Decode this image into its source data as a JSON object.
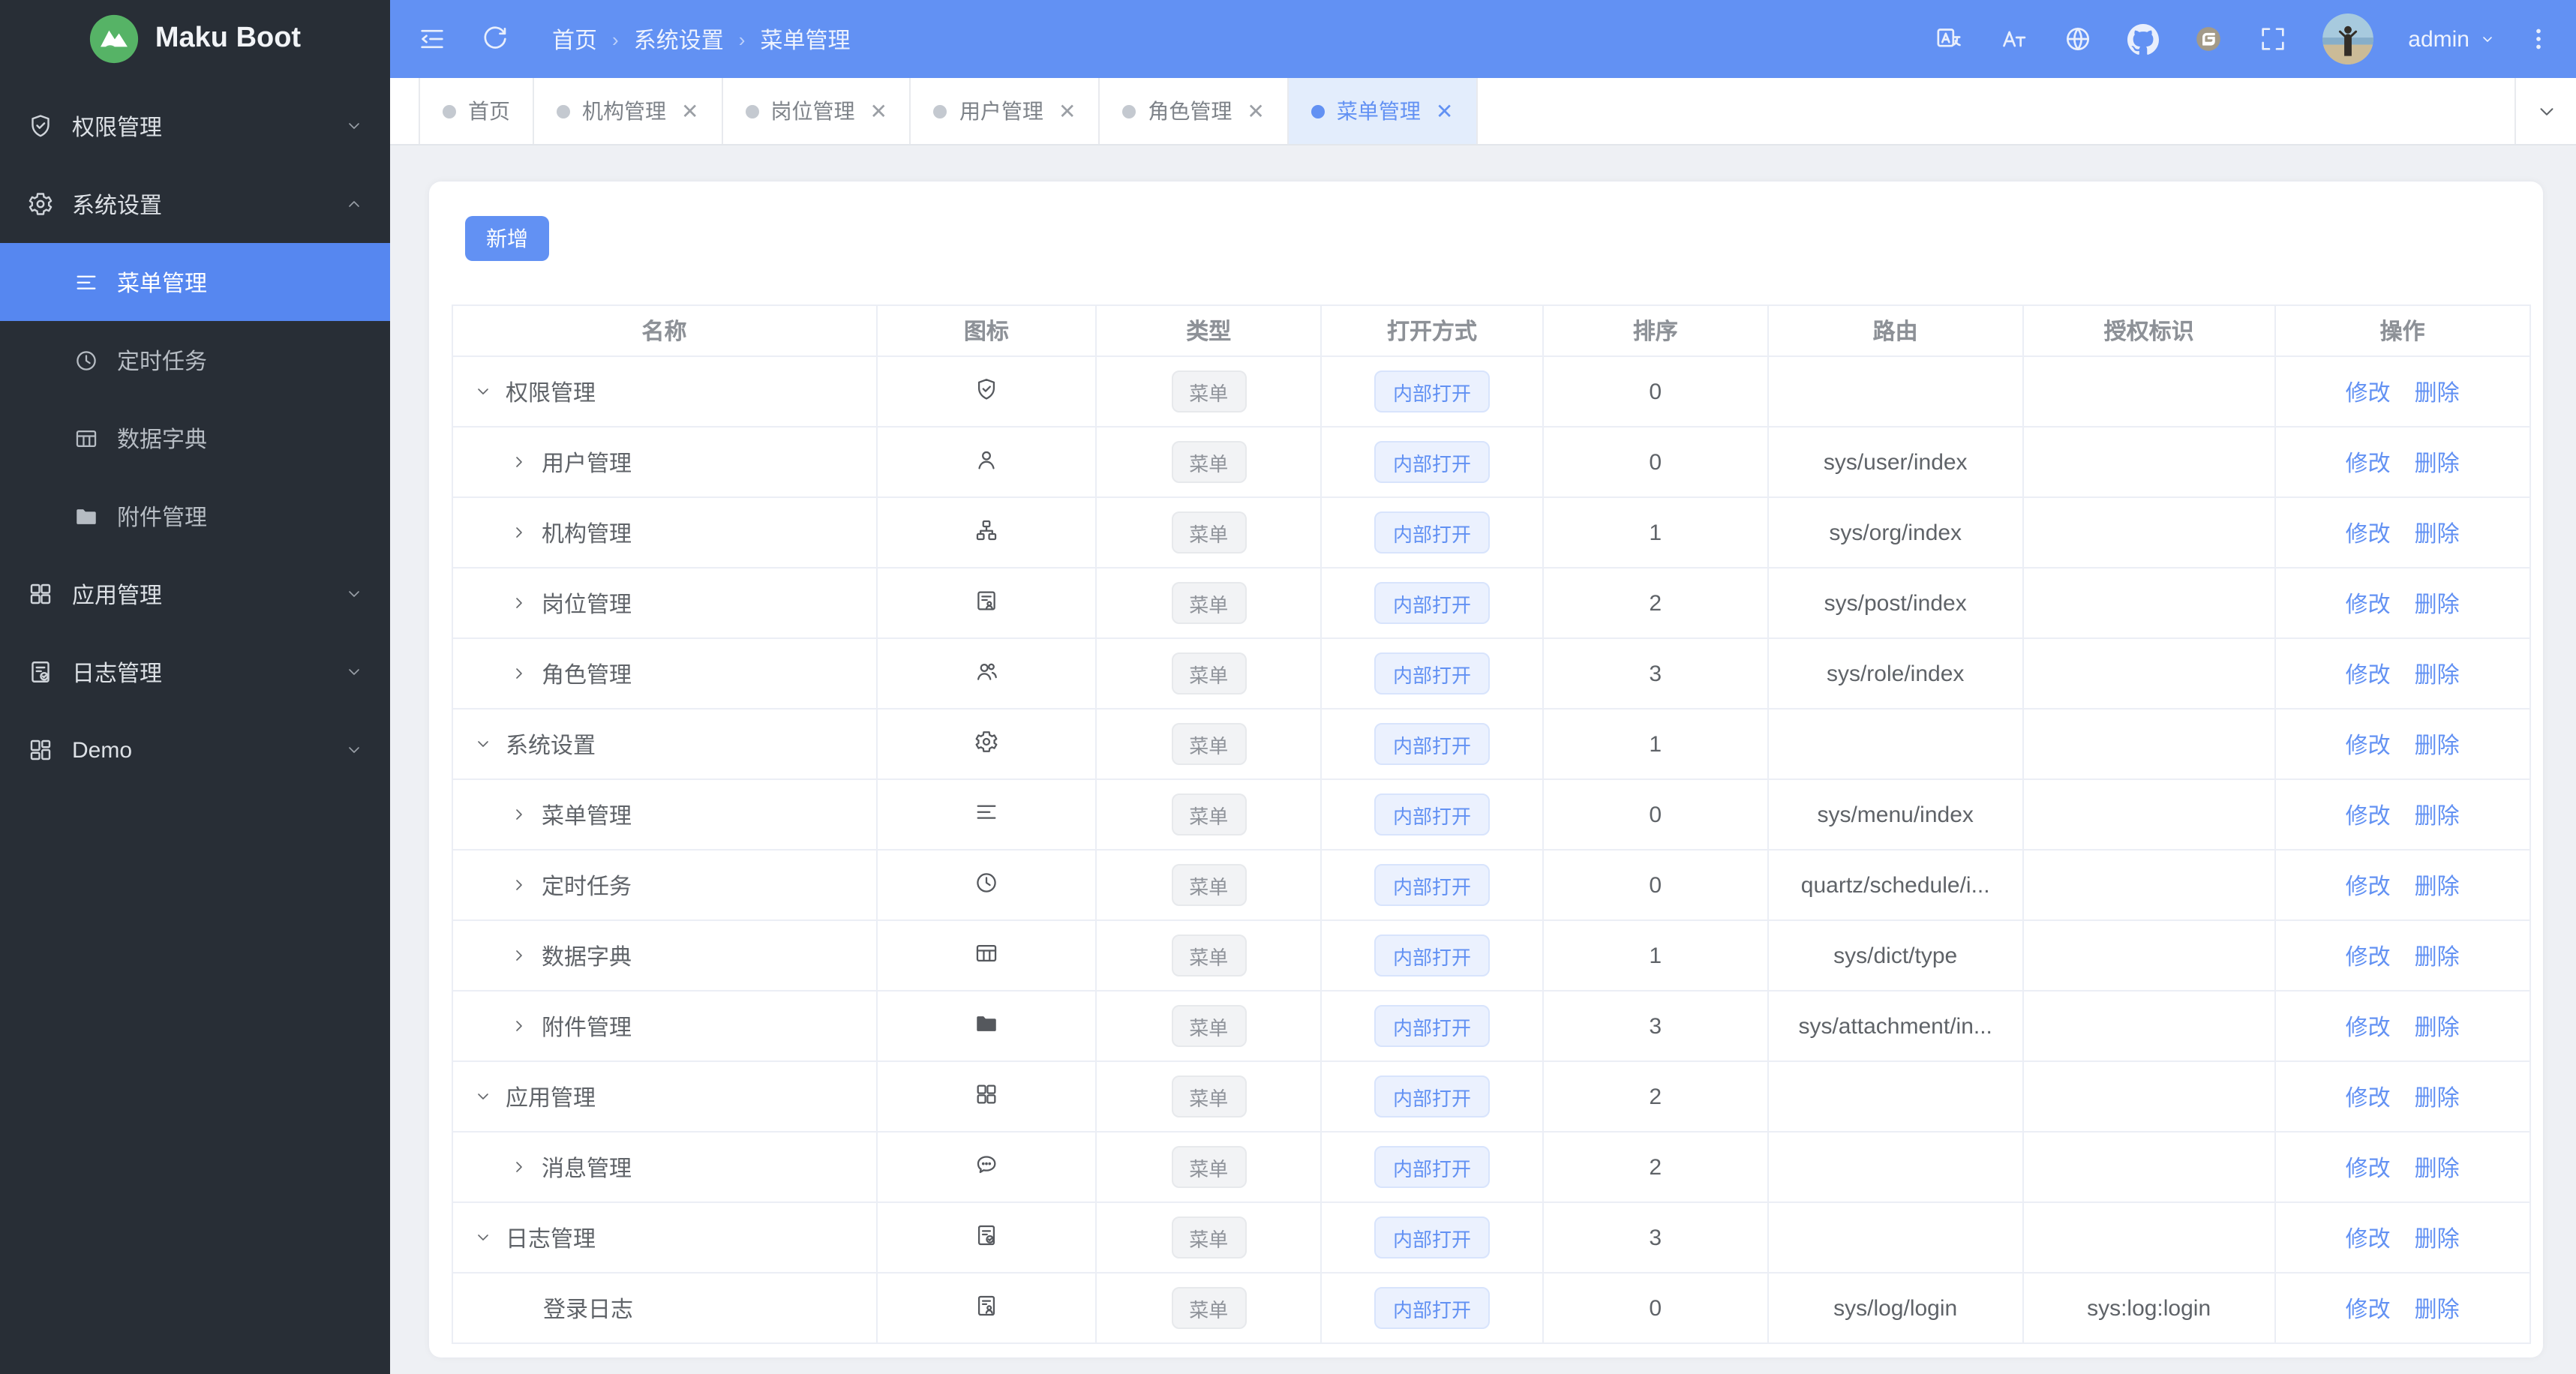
{
  "app": {
    "title": "Maku Boot"
  },
  "colors": {
    "accent": "#6291f3",
    "header_bg": "#6291f3",
    "sidebar_bg": "#282e36",
    "sidebar_active_bg": "#5687f0",
    "content_bg": "#eef0f4",
    "logo_green": "#56b366",
    "tag_gray_bg": "#f2f3f5",
    "tag_blue_bg": "#ebf1fe",
    "link_blue": "#6291f3"
  },
  "sidebar": {
    "items": [
      {
        "key": "auth-mgmt",
        "label": "权限管理",
        "icon": "shield-check",
        "arrow": "down"
      },
      {
        "key": "system-settings",
        "label": "系统设置",
        "icon": "gear",
        "arrow": "up",
        "children": [
          {
            "key": "menu-mgmt",
            "label": "菜单管理",
            "icon": "menu-list",
            "active": true
          },
          {
            "key": "scheduled-tasks",
            "label": "定时任务",
            "icon": "clock"
          },
          {
            "key": "data-dict",
            "label": "数据字典",
            "icon": "dict-table"
          },
          {
            "key": "attachment-mgmt",
            "label": "附件管理",
            "icon": "folder"
          }
        ]
      },
      {
        "key": "app-mgmt",
        "label": "应用管理",
        "icon": "grid",
        "arrow": "down"
      },
      {
        "key": "log-mgmt",
        "label": "日志管理",
        "icon": "doc-check",
        "arrow": "down"
      },
      {
        "key": "demo",
        "label": "Demo",
        "icon": "grid-alt",
        "arrow": "down"
      }
    ]
  },
  "header": {
    "breadcrumb": [
      "首页",
      "系统设置",
      "菜单管理"
    ],
    "tools_left": [
      "collapse",
      "refresh"
    ],
    "tools_right": [
      "translate",
      "font-size",
      "globe",
      "github",
      "gitee",
      "fullscreen"
    ],
    "user": "admin"
  },
  "tabs": [
    {
      "key": "home",
      "label": "首页",
      "closable": false,
      "active": false
    },
    {
      "key": "org-mgmt",
      "label": "机构管理",
      "closable": true,
      "active": false
    },
    {
      "key": "post-mgmt",
      "label": "岗位管理",
      "closable": true,
      "active": false
    },
    {
      "key": "user-mgmt",
      "label": "用户管理",
      "closable": true,
      "active": false
    },
    {
      "key": "role-mgmt",
      "label": "角色管理",
      "closable": true,
      "active": false
    },
    {
      "key": "menu-mgmt",
      "label": "菜单管理",
      "closable": true,
      "active": true
    }
  ],
  "toolbar": {
    "add_label": "新增"
  },
  "table": {
    "columns": [
      "名称",
      "图标",
      "类型",
      "打开方式",
      "排序",
      "路由",
      "授权标识",
      "操作"
    ],
    "type_tag": "菜单",
    "open_tag": "内部打开",
    "actions": [
      "修改",
      "删除"
    ],
    "rows": [
      {
        "name": "权限管理",
        "icon": "shield-check",
        "level": 0,
        "expand": "down",
        "sort": "0",
        "route": "",
        "auth": ""
      },
      {
        "name": "用户管理",
        "icon": "user",
        "level": 1,
        "expand": "right",
        "sort": "0",
        "route": "sys/user/index",
        "auth": ""
      },
      {
        "name": "机构管理",
        "icon": "org",
        "level": 1,
        "expand": "right",
        "sort": "1",
        "route": "sys/org/index",
        "auth": ""
      },
      {
        "name": "岗位管理",
        "icon": "id-badge",
        "level": 1,
        "expand": "right",
        "sort": "2",
        "route": "sys/post/index",
        "auth": ""
      },
      {
        "name": "角色管理",
        "icon": "user-group",
        "level": 1,
        "expand": "right",
        "sort": "3",
        "route": "sys/role/index",
        "auth": ""
      },
      {
        "name": "系统设置",
        "icon": "gear",
        "level": 0,
        "expand": "down",
        "sort": "1",
        "route": "",
        "auth": ""
      },
      {
        "name": "菜单管理",
        "icon": "menu-list",
        "level": 1,
        "expand": "right",
        "sort": "0",
        "route": "sys/menu/index",
        "auth": ""
      },
      {
        "name": "定时任务",
        "icon": "clock",
        "level": 1,
        "expand": "right",
        "sort": "0",
        "route": "quartz/schedule/i...",
        "auth": ""
      },
      {
        "name": "数据字典",
        "icon": "dict-table",
        "level": 1,
        "expand": "right",
        "sort": "1",
        "route": "sys/dict/type",
        "auth": ""
      },
      {
        "name": "附件管理",
        "icon": "folder",
        "level": 1,
        "expand": "right",
        "sort": "3",
        "route": "sys/attachment/in...",
        "auth": ""
      },
      {
        "name": "应用管理",
        "icon": "grid",
        "level": 0,
        "expand": "down",
        "sort": "2",
        "route": "",
        "auth": ""
      },
      {
        "name": "消息管理",
        "icon": "chat",
        "level": 1,
        "expand": "right",
        "sort": "2",
        "route": "",
        "auth": ""
      },
      {
        "name": "日志管理",
        "icon": "doc-check",
        "level": 0,
        "expand": "down",
        "sort": "3",
        "route": "",
        "auth": ""
      },
      {
        "name": "登录日志",
        "icon": "id-person",
        "level": 1,
        "expand": "none",
        "sort": "0",
        "route": "sys/log/login",
        "auth": "sys:log:login"
      }
    ]
  }
}
